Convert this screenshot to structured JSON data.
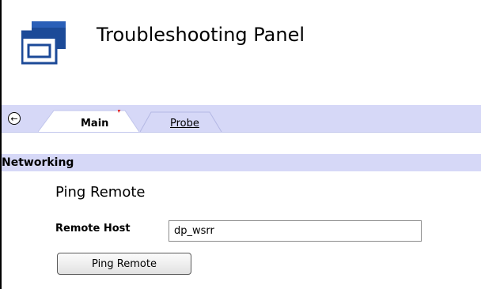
{
  "header": {
    "title": "Troubleshooting Panel",
    "icon": "windows-panel-icon"
  },
  "tabs": {
    "back_icon": "back-arrow-icon",
    "back_glyph": "←",
    "items": [
      {
        "label": "Main",
        "active": true
      },
      {
        "label": "Probe",
        "active": false
      }
    ]
  },
  "section": {
    "title": "Networking"
  },
  "ping_form": {
    "title": "Ping Remote",
    "remote_host_label": "Remote Host",
    "remote_host_value": "dp_wsrr",
    "submit_label": "Ping Remote"
  },
  "colors": {
    "tab_bar_bg": "#d6d8f7",
    "icon_blue": "#1c4a98",
    "active_tab_accent": "#e02222"
  }
}
